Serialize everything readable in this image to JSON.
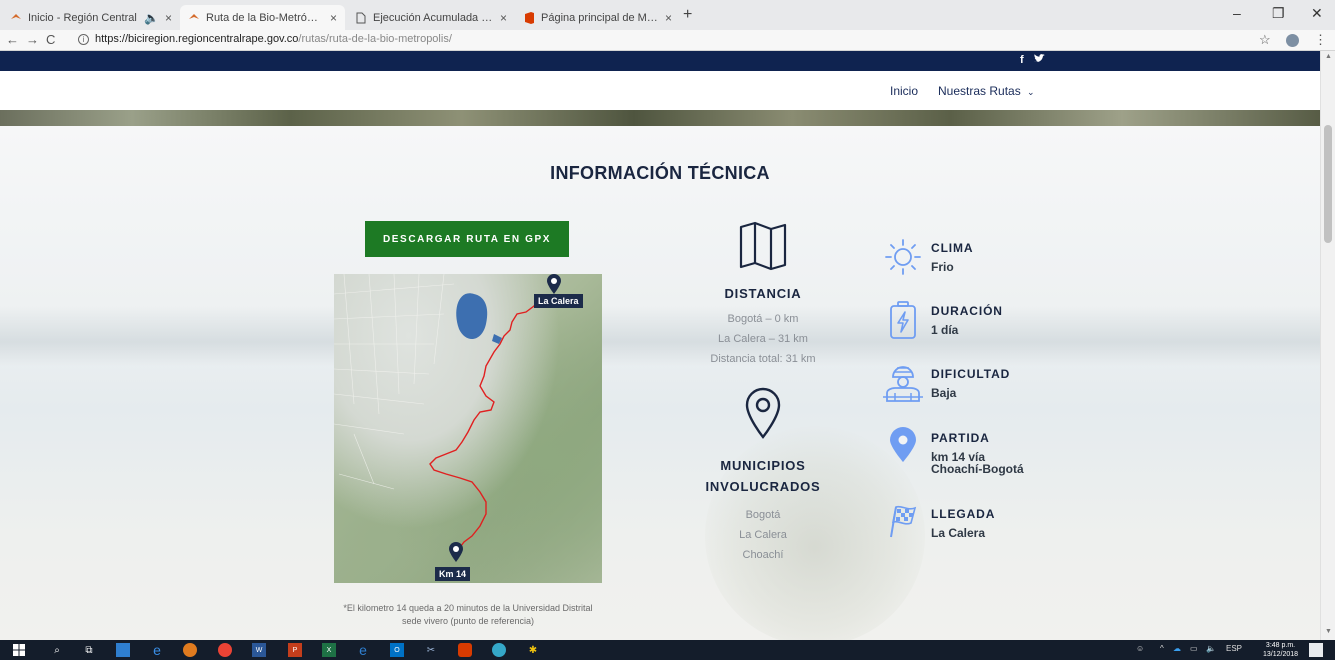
{
  "browser": {
    "tabs": [
      {
        "label": "Inicio - Región Central",
        "favicon": "bicycle-favicon",
        "active": false
      },
      {
        "label": "Ruta de la Bio-Metrópolis | Bicire",
        "favicon": "bicycle-favicon",
        "active": true
      },
      {
        "label": "Ejecución Acumulada Egresos - P",
        "favicon": "document-favicon",
        "active": false
      },
      {
        "label": "Página principal de Microsoft Off",
        "favicon": "office-favicon",
        "active": false
      }
    ],
    "new_tab": "+",
    "url_host": "https://biciregion.regioncentralrape.gov.co",
    "url_path": "/rutas/ruta-de-la-bio-metropolis/"
  },
  "site": {
    "social": [
      "f",
      "twitter-bird"
    ],
    "nav": {
      "home": "Inicio",
      "routes": "Nuestras Rutas"
    },
    "section_title": "INFORMACIÓN TÉCNICA",
    "download_button": "DESCARGAR RUTA EN GPX",
    "map": {
      "start_label": "Km 14",
      "end_label": "La Calera"
    },
    "note": "*El kilometro 14 queda a 20 minutos de la Universidad Distrital sede vivero (punto de referencia)",
    "distance": {
      "title": "DISTANCIA",
      "lines": [
        "Bogotá – 0 km",
        "La Calera – 31 km",
        "Distancia total: 31 km"
      ]
    },
    "municipalities": {
      "title_line1": "MUNICIPIOS",
      "title_line2": "INVOLUCRADOS",
      "lines": [
        "Bogotá",
        "La Calera",
        "Choachí"
      ]
    },
    "info": [
      {
        "title": "CLIMA",
        "value": "Frio",
        "icon": "sun-icon"
      },
      {
        "title": "DURACIÓN",
        "value": "1 día",
        "icon": "battery-icon"
      },
      {
        "title": "DIFICULTAD",
        "value": "Baja",
        "icon": "cyclist-icon"
      },
      {
        "title": "PARTIDA",
        "value_line1": "km 14 vía",
        "value_line2": "Choachí-Bogotá",
        "icon": "map-pin-icon"
      },
      {
        "title": "LLEGADA",
        "value": "La Calera",
        "icon": "checkered-flag-icon"
      }
    ]
  },
  "taskbar": {
    "lang": "ESP",
    "time": "3:48 p.m.",
    "date": "13/12/2018"
  },
  "colors": {
    "navy": "#0f2350",
    "green_button": "#1d7a24",
    "icon_blue": "#6f9df2",
    "heading": "#1a2640",
    "route_red": "#e02020"
  }
}
